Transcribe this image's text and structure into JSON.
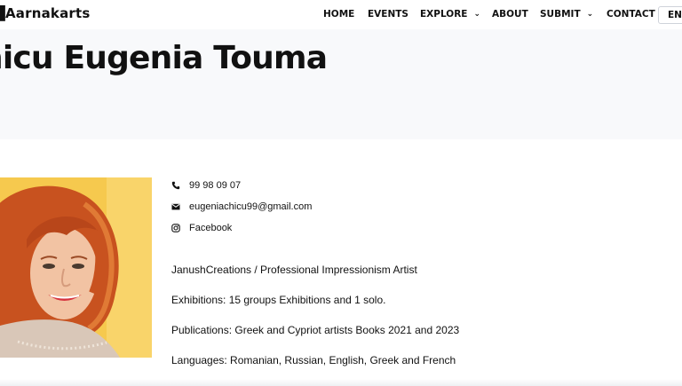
{
  "header": {
    "logo": "Aarnakarts",
    "nav": [
      {
        "label": "HOME",
        "dropdown": false
      },
      {
        "label": "EVENTS",
        "dropdown": false
      },
      {
        "label": "EXPLORE",
        "dropdown": true
      },
      {
        "label": "ABOUT",
        "dropdown": false
      },
      {
        "label": "SUBMIT",
        "dropdown": true
      },
      {
        "label": "CONTACT",
        "dropdown": false
      }
    ],
    "language": "ENG"
  },
  "hero": {
    "title": "hicu Eugenia Touma"
  },
  "contact": {
    "phone": "99 98 09 07",
    "email": "eugeniachicu99@gmail.com",
    "social": "Facebook",
    "icons": [
      "phone-icon",
      "envelope-icon",
      "instagram-icon"
    ]
  },
  "bio": {
    "lines": [
      "JanushCreations / Professional Impressionism Artist",
      "Exhibitions: 15 groups Exhibitions and 1 solo.",
      "Publications: Greek and Cypriot artists Books 2021 and 2023",
      "Languages: Romanian, Russian, English, Greek and French"
    ]
  },
  "colors": {
    "hero_bg": "#f8f9fb",
    "photo_bg": "#f6c94e",
    "hair": "#c8521f",
    "text": "#111111"
  }
}
